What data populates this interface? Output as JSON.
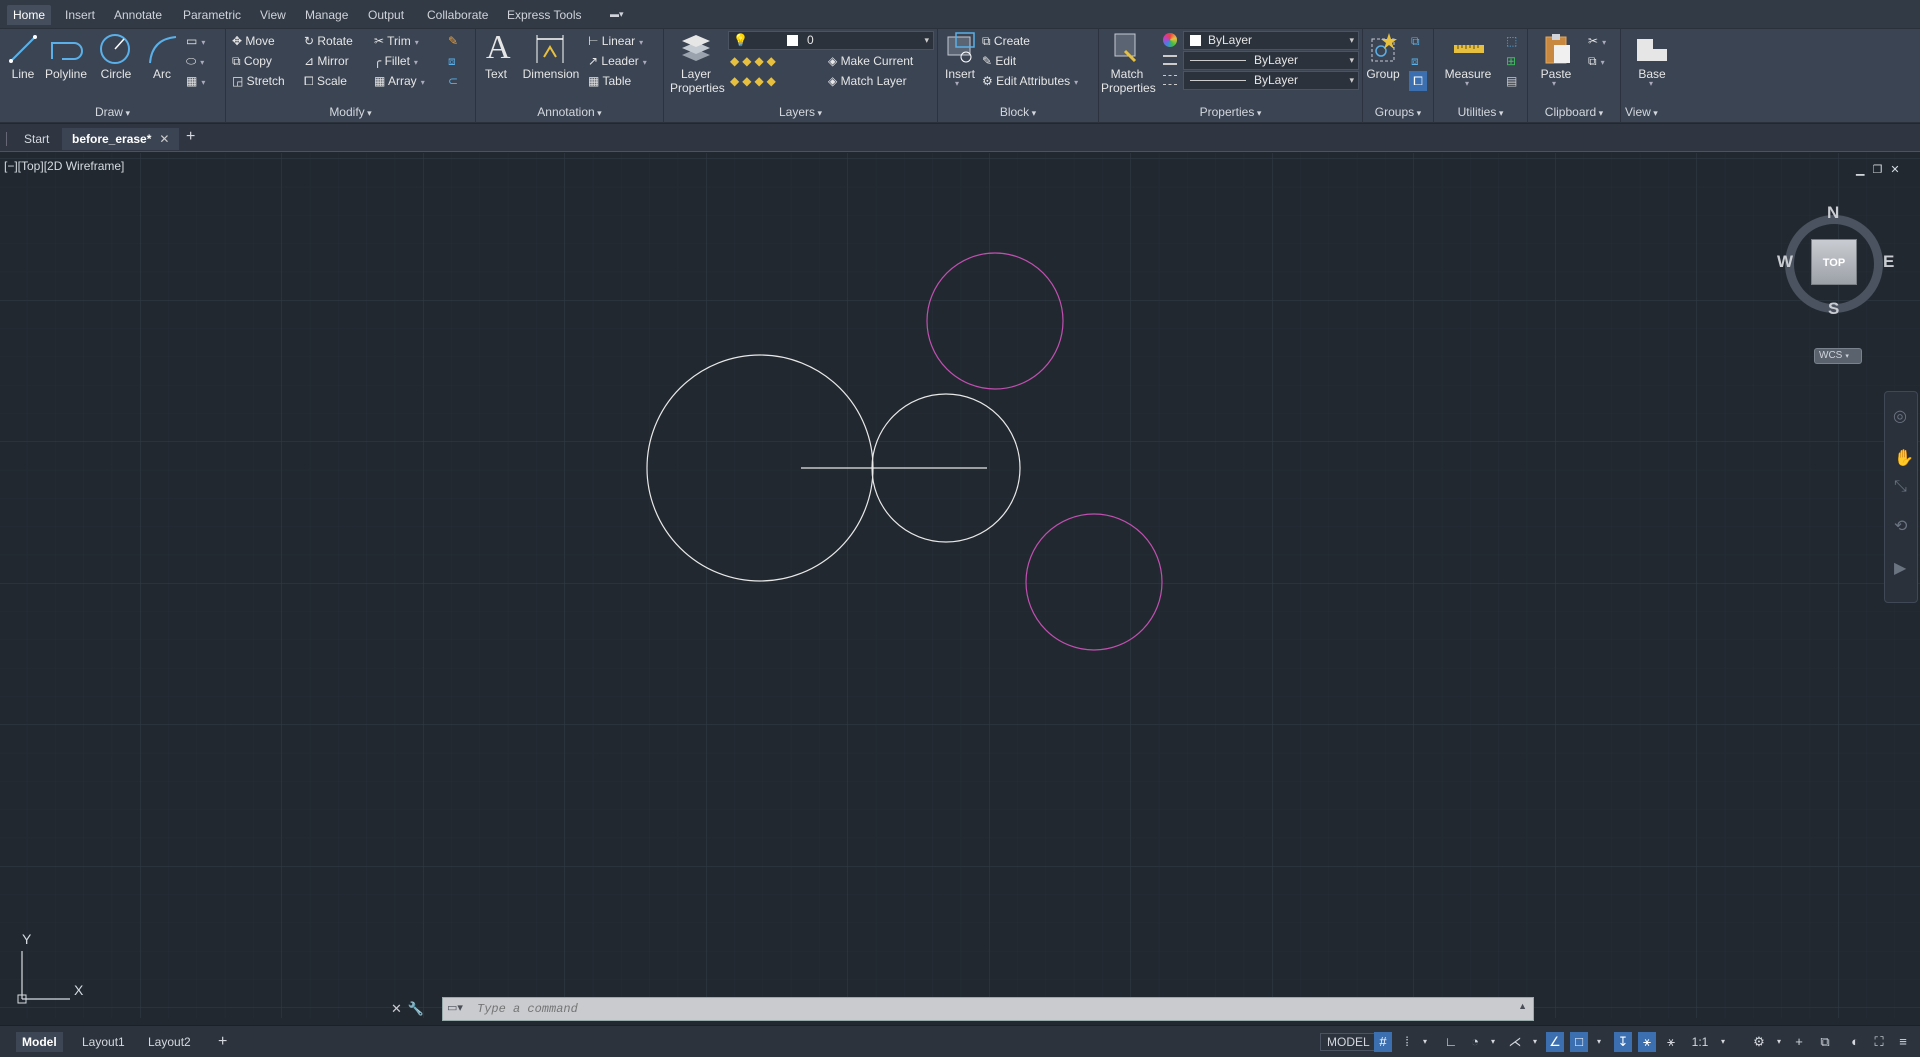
{
  "ribbon_tabs": [
    "Home",
    "Insert",
    "Annotate",
    "Parametric",
    "View",
    "Manage",
    "Output",
    "Collaborate",
    "Express Tools"
  ],
  "draw": {
    "title": "Draw",
    "line": "Line",
    "polyline": "Polyline",
    "circle": "Circle",
    "arc": "Arc"
  },
  "modify": {
    "title": "Modify",
    "move": "Move",
    "rotate": "Rotate",
    "trim": "Trim",
    "copy": "Copy",
    "mirror": "Mirror",
    "fillet": "Fillet",
    "stretch": "Stretch",
    "scale": "Scale",
    "array": "Array"
  },
  "annotation": {
    "title": "Annotation",
    "text": "Text",
    "dimension": "Dimension",
    "linear": "Linear",
    "leader": "Leader",
    "table": "Table"
  },
  "layers": {
    "title": "Layers",
    "layer_properties": "Layer Properties",
    "current_layer": "0",
    "make_current": "Make Current",
    "match_layer": "Match Layer"
  },
  "block": {
    "title": "Block",
    "insert": "Insert",
    "create": "Create",
    "edit": "Edit",
    "edit_attributes": "Edit Attributes"
  },
  "properties": {
    "title": "Properties",
    "match_properties": "Match Properties",
    "color": "ByLayer",
    "linetype": "ByLayer",
    "lineweight": "ByLayer"
  },
  "groups": {
    "title": "Groups",
    "group": "Group"
  },
  "utilities": {
    "title": "Utilities",
    "measure": "Measure"
  },
  "clipboard": {
    "title": "Clipboard",
    "paste": "Paste"
  },
  "view": {
    "title": "View",
    "base": "Base"
  },
  "file_tabs": {
    "start": "Start",
    "active": "before_erase*"
  },
  "viewport_label": "[−][Top][2D Wireframe]",
  "viewcube": {
    "n": "N",
    "s": "S",
    "e": "E",
    "w": "W",
    "top": "TOP",
    "wcs": "WCS"
  },
  "ucs": {
    "x": "X",
    "y": "Y"
  },
  "command": {
    "placeholder": "Type a command"
  },
  "layout_tabs": [
    "Model",
    "Layout1",
    "Layout2"
  ],
  "status": {
    "model": "MODEL",
    "scale": "1:1"
  },
  "colors": {
    "background": "#212830",
    "ribbon": "#3b4453",
    "magenta": "#c050b0",
    "white_geom": "#e8e8e8"
  }
}
